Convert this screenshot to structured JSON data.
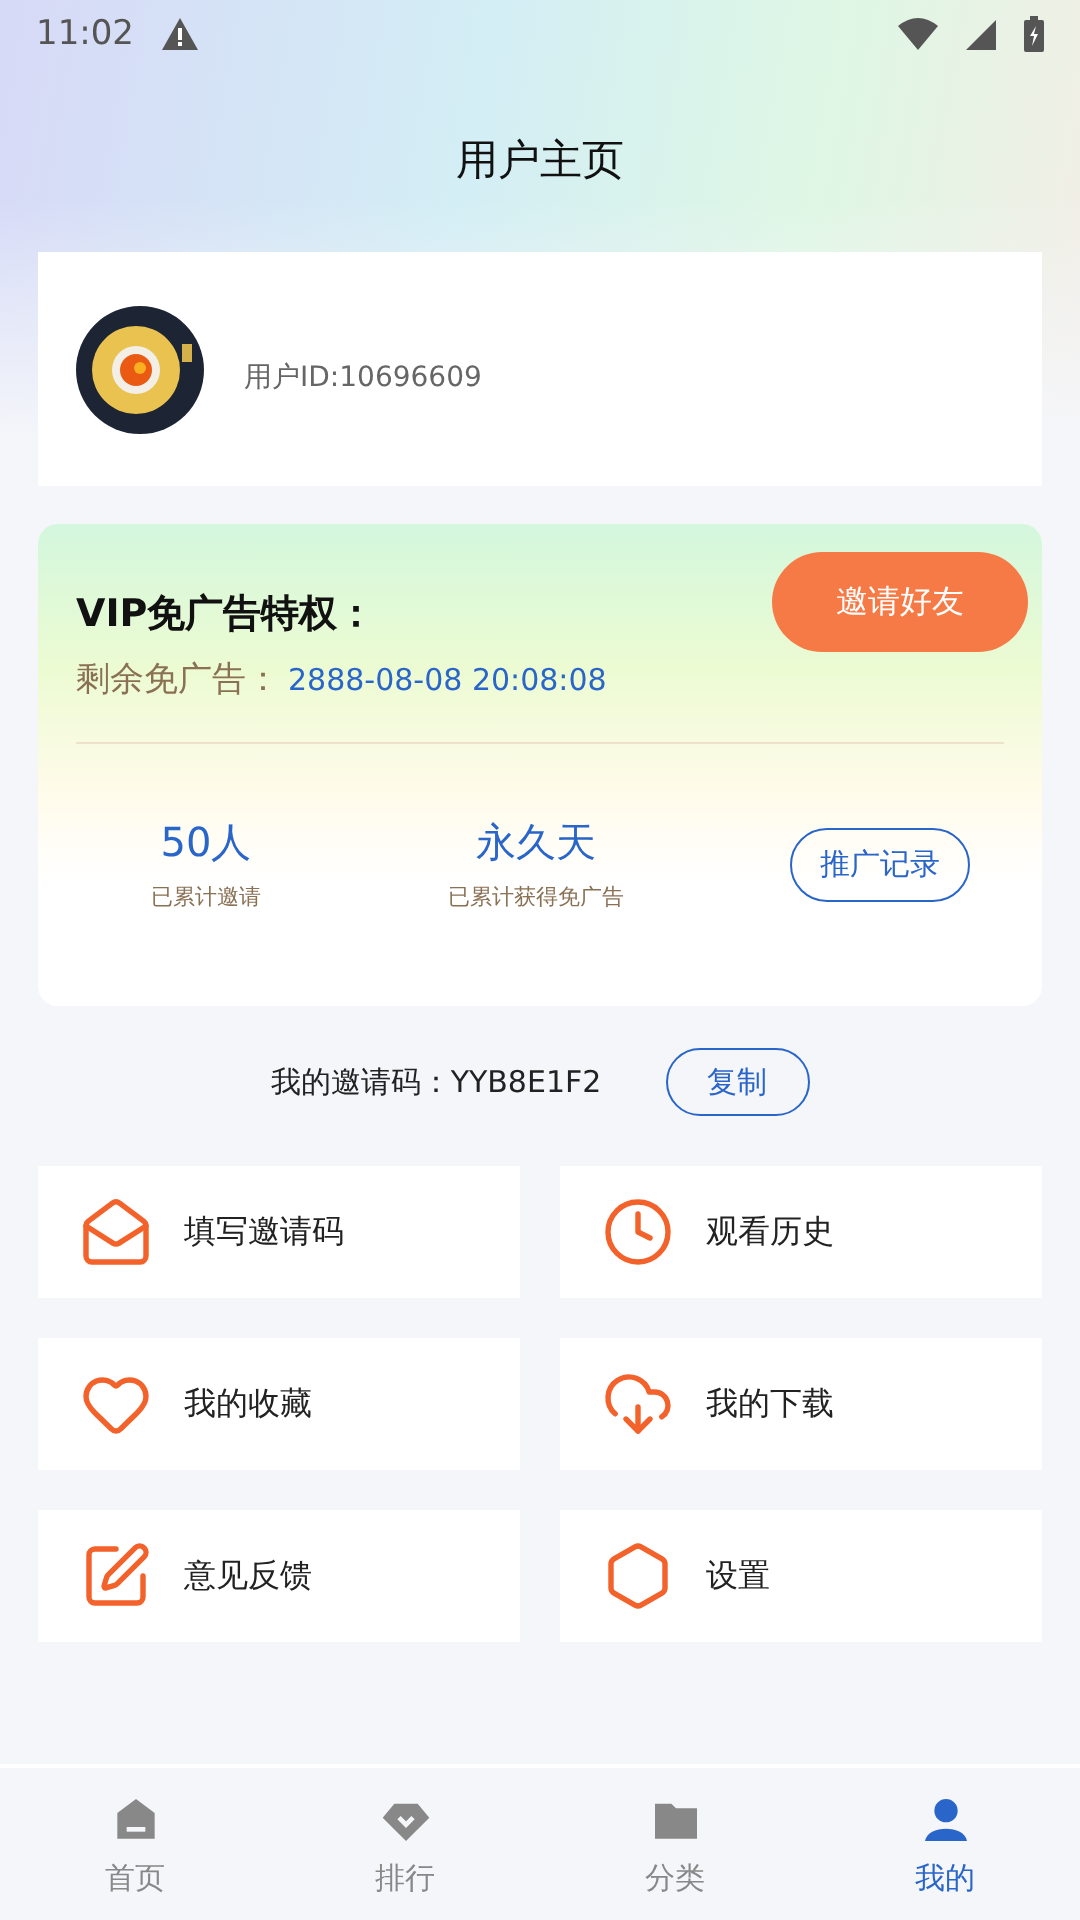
{
  "status_bar": {
    "time": "11:02"
  },
  "header": {
    "title": "用户主页"
  },
  "profile": {
    "user_id": "用户ID:10696609"
  },
  "vip": {
    "title": "VIP免广告特权：",
    "invite_button": "邀请好友",
    "remaining_label": "剩余免广告：",
    "remaining_value": "2888-08-08 20:08:08",
    "stats": [
      {
        "value": "50人",
        "label": "已累计邀请"
      },
      {
        "value": "永久天",
        "label": "已累计获得免广告"
      }
    ],
    "records_button": "推广记录"
  },
  "invite_code": {
    "label": "我的邀请码：YYB8E1F2",
    "copy_button": "复制"
  },
  "menu": [
    {
      "kind": "envelope",
      "label": "填写邀请码"
    },
    {
      "kind": "clock",
      "label": "观看历史"
    },
    {
      "kind": "heart",
      "label": "我的收藏"
    },
    {
      "kind": "download",
      "label": "我的下载"
    },
    {
      "kind": "edit",
      "label": "意见反馈"
    },
    {
      "kind": "settings",
      "label": "设置"
    }
  ],
  "tabs": [
    {
      "kind": "home",
      "label": "首页",
      "selected": false
    },
    {
      "kind": "rank",
      "label": "排行",
      "selected": false
    },
    {
      "kind": "category",
      "label": "分类",
      "selected": false
    },
    {
      "kind": "me",
      "label": "我的",
      "selected": true
    }
  ]
}
